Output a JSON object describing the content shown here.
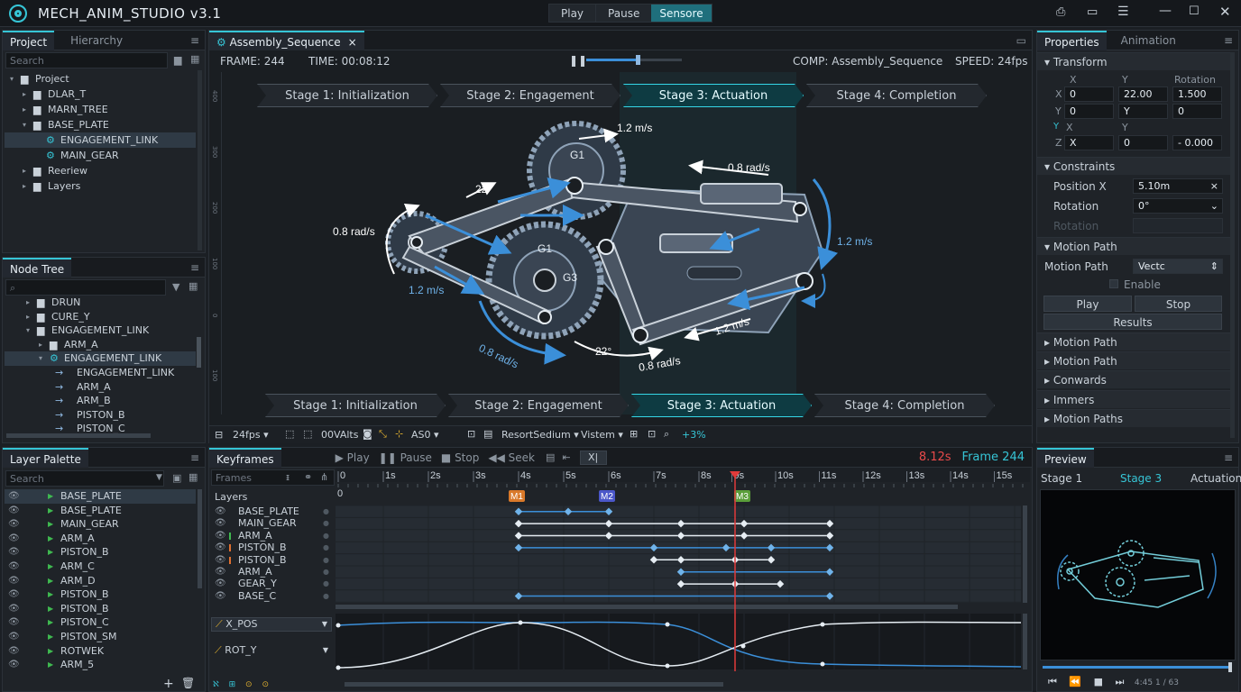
{
  "app": {
    "title": "MECH_ANIM_STUDIO v3.1",
    "modes": [
      "Play",
      "Pause",
      "Sensore"
    ],
    "active_mode": "Sensore"
  },
  "project": {
    "tabs": [
      "Project",
      "Hierarchy"
    ],
    "search_placeholder": "Search",
    "tree": [
      {
        "label": "Project",
        "depth": 0,
        "open": true
      },
      {
        "label": "DLAR_T",
        "depth": 1
      },
      {
        "label": "MARN_TREE",
        "depth": 1,
        "arrow": true
      },
      {
        "label": "BASE_PLATE",
        "depth": 1,
        "open": true
      },
      {
        "label": "ENGAGEMENT_LINK",
        "depth": 2,
        "sel": true,
        "gear": true
      },
      {
        "label": "MAIN_GEAR",
        "depth": 2,
        "gear": true
      },
      {
        "label": "Reeriew",
        "depth": 1,
        "arrow": true
      },
      {
        "label": "Layers",
        "depth": 1,
        "arrow": true
      }
    ]
  },
  "nodetree": {
    "tab": "Node Tree",
    "tree": [
      {
        "label": "DRUN",
        "depth": 1
      },
      {
        "label": "CURE_Y",
        "depth": 1
      },
      {
        "label": "ENGAGEMENT_LINK",
        "depth": 1,
        "open": true
      },
      {
        "label": "ARM_A",
        "depth": 2
      },
      {
        "label": "ENGAGEMENT_LINK",
        "depth": 2,
        "sel": true
      },
      {
        "label": "ENGAGEMENT_LINK",
        "depth": 3
      },
      {
        "label": "ARM_A",
        "depth": 3
      },
      {
        "label": "ARM_B",
        "depth": 3
      },
      {
        "label": "PISTON_B",
        "depth": 3
      },
      {
        "label": "PISTON_C",
        "depth": 3
      }
    ]
  },
  "layerpalette": {
    "tab": "Layer Palette",
    "search_placeholder": "Search",
    "items": [
      "BASE_PLATE",
      "BASE_PLATE",
      "MAIN_GEAR",
      "ARM_A",
      "PISTON_B",
      "ARM_C",
      "ARM_D",
      "PISTON_B",
      "PISTON_B",
      "PISTON_C",
      "PISTON_SM",
      "ROTWEK",
      "ARM_5"
    ]
  },
  "viewport": {
    "tab": "Assembly_Sequence",
    "frame": "FRAME: 244",
    "time": "TIME: 00:08:12",
    "comp": "COMP: Assembly_Sequence",
    "speed": "SPEED: 24fps",
    "stages": [
      "Stage 1: Initialization",
      "Stage 2: Engagement",
      "Stage 3: Actuation",
      "Stage 4: Completion"
    ],
    "active_stage": 2,
    "labels": {
      "g1a": "G1",
      "g1b": "G1",
      "g3": "G3",
      "v1": "1.2 m/s",
      "v2": "0.8 rad/s",
      "v3": "1.2 m/s",
      "v4": "0.8 rad/s",
      "v5": "1.2 m/s",
      "v6": "0.8 rad/s",
      "v7": "1.2 m/s",
      "v8": "0.8 rad/s",
      "a1": "22°",
      "a2": "22°"
    },
    "toolbar": {
      "fps": "24fps",
      "t1": "00VAlts",
      "t2": "AS0",
      "t3": "ResortSedium",
      "t4": "Vistem",
      "t5": "+3%"
    },
    "ruler": [
      "400",
      "300",
      "200",
      "100",
      "0",
      "100"
    ]
  },
  "properties": {
    "tabs": [
      "Properties",
      "Animation"
    ],
    "transform": {
      "title": "Transform",
      "cols": [
        "X",
        "Y",
        "Rotation"
      ],
      "r1": [
        "X",
        "0",
        "22.00",
        "1.500"
      ],
      "r2": [
        "Y",
        "0",
        "Y",
        "0"
      ],
      "r3": [
        "X",
        "Y"
      ],
      "r4": [
        "Z",
        "X",
        "0",
        "- 0.000"
      ]
    },
    "constraints": {
      "title": "Constraints",
      "posx_label": "Position X",
      "posx": "5.10m",
      "rot_label": "Rotation",
      "rot": "0°",
      "rot2_label": "Rotation"
    },
    "motionpath": {
      "title": "Motion Path",
      "label": "Motion Path",
      "value": "Vectc",
      "enable": "Enable",
      "play": "Play",
      "stop": "Stop",
      "results": "Results"
    },
    "collapsed": [
      "Motion Path",
      "Motion Path",
      "Conwards",
      "Immers",
      "Motion Paths"
    ]
  },
  "keyframes": {
    "tab": "Keyframes",
    "controls": [
      "Play",
      "Pause",
      "Stop",
      "Seek"
    ],
    "time": "8.12s",
    "frame": "Frame 244",
    "frames_label": "Frames",
    "layers_label": "Layers",
    "ticks": [
      "0",
      "1s",
      "2s",
      "3s",
      "4s",
      "5s",
      "6s",
      "7s",
      "8s",
      "9s",
      "10s",
      "11s",
      "12s",
      "13s",
      "14s",
      "15s"
    ],
    "markers": [
      "M1",
      "M2",
      "M3"
    ],
    "layers": [
      "BASE_PLATE",
      "MAIN_GEAR",
      "ARM_A",
      "PISTON_B",
      "PISTON_B",
      "ARM_A",
      "GEAR_Y",
      "BASE_C"
    ],
    "curves": [
      "X_POS",
      "ROT_Y"
    ]
  },
  "preview": {
    "tab": "Preview",
    "s1": "Stage 1",
    "s3": "Stage 3",
    "act": "Actuation",
    "time": "4:45 1 / 63"
  },
  "colors": {
    "accent": "#36c5d6",
    "blue": "#3b8fd9",
    "playhead": "#e03a3a",
    "m1": "#d9792a",
    "m2": "#4b57c9",
    "m3": "#5a9e3a"
  }
}
